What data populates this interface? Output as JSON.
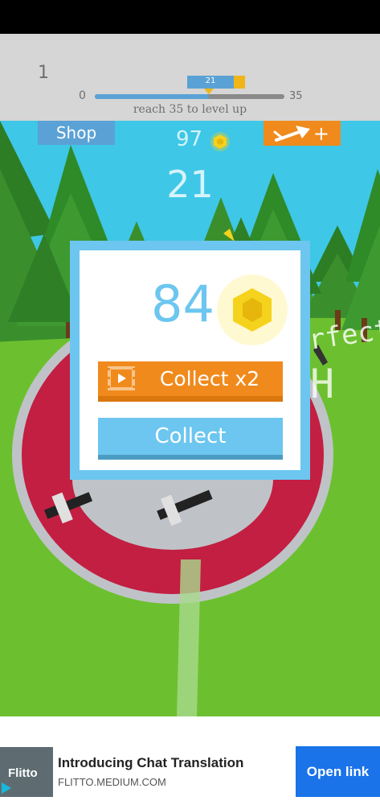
{
  "colors": {
    "sky": "#3ec7e6",
    "grass": "#6cc02f",
    "accent_blue": "#6cc6ef",
    "accent_orange": "#f08a1c",
    "target_red": "#c21f42",
    "coin_yellow": "#f5d21c",
    "ad_button": "#1a73e8"
  },
  "level_bar": {
    "current_level": "1",
    "min": "0",
    "max": "35",
    "progress_value": "21",
    "progress_fraction": 0.6,
    "hint": "reach 35 to level up"
  },
  "hud": {
    "shop_label": "Shop",
    "coins": "97",
    "coin_icon": "coin-icon",
    "score": "21",
    "arrow_upgrade_icon": "arrow-plus-icon",
    "arrow_upgrade_plus": "+",
    "background_text_1": "rfect",
    "background_text_2": "H"
  },
  "reward_dialog": {
    "amount": "84",
    "coin_icon": "coin-icon",
    "collect_x2_label": "Collect x2",
    "video_icon": "video-icon",
    "collect_label": "Collect"
  },
  "ad": {
    "brand": "Flitto",
    "title": "Introducing Chat Translation",
    "url": "FLITTO.MEDIUM.COM",
    "button_label": "Open link"
  }
}
